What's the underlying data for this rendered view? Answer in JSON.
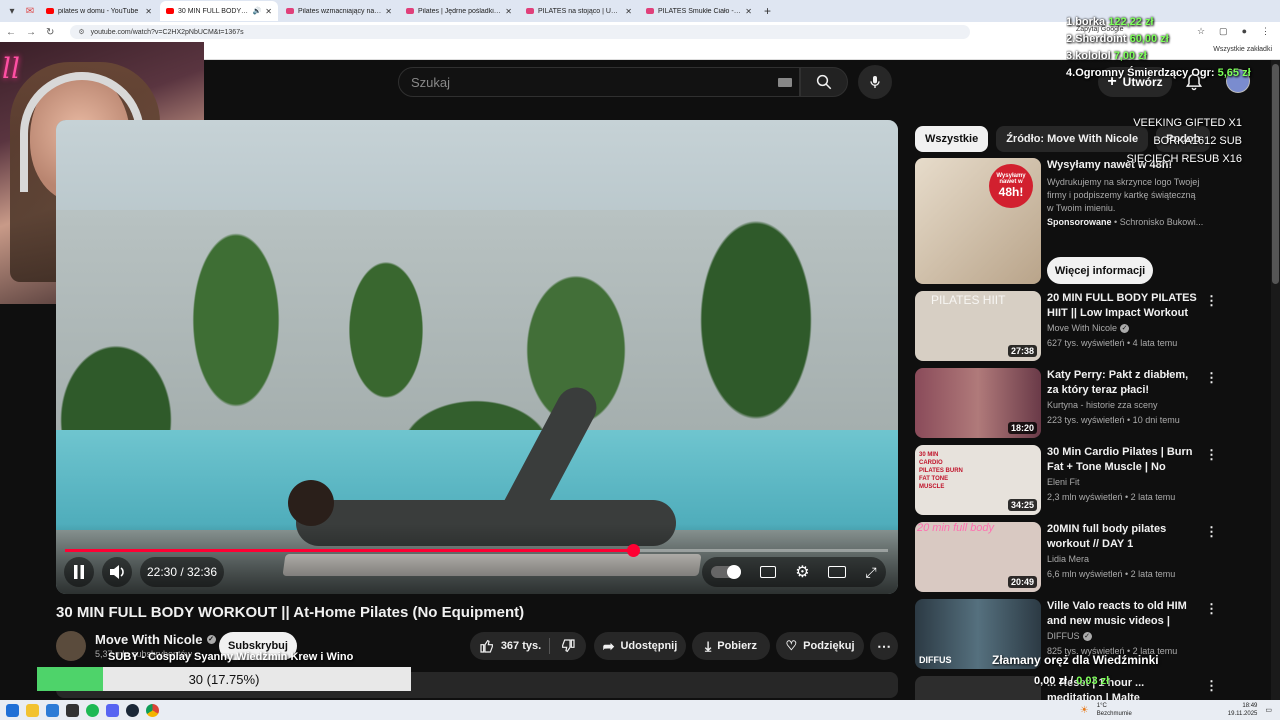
{
  "browser": {
    "tabs": [
      {
        "label": "pilates w domu - YouTube",
        "active": false
      },
      {
        "label": "30 MIN FULL BODY WORKO...",
        "active": true
      },
      {
        "label": "Pilates wzmacniający na całe ciało",
        "active": false
      },
      {
        "label": "Pilates | Jędrne pośladki i płaski",
        "active": false
      },
      {
        "label": "PILATES na stojąco | Uda i Brzuch",
        "active": false
      },
      {
        "label": "PILATES Smukłe Ciało - YouTube",
        "active": false
      }
    ],
    "url": "youtube.com/watch?v=C2HX2pNbUCM&t=1367s",
    "translate_label": "Zapytaj Google",
    "bookmarks_label": "Wszystkie zakładki"
  },
  "overlay": {
    "donations": [
      {
        "rank": "1.",
        "name": "borka",
        "amount": "122,22 zł"
      },
      {
        "rank": "2.",
        "name": "Sherdoint",
        "amount": "60,00 zł"
      },
      {
        "rank": "3.",
        "name": "kololol",
        "amount": "7,00 zł"
      },
      {
        "rank": "4.",
        "name": "Ogromny Śmierdzący Ogr:",
        "amount": "5,65 zł"
      }
    ],
    "gifted": [
      "VEEKING GIFTED X1",
      "BORKA1612 SUB",
      "SIECIECH RESUB X16"
    ],
    "subgoal_title": "SUBY - Cosplay Syanny Wiedźmin Krew i Wino",
    "subgoal_text": "30 (17.75%)",
    "subgoal_progress": 0.1775,
    "overlay_wiedz": "Złamany oręż dla Wiedźminki",
    "overlay_price_a": "0,00 zł",
    "overlay_price_b": "0,03 zł"
  },
  "header": {
    "search_placeholder": "Szukaj",
    "create_label": "Utwórz"
  },
  "player": {
    "time": "22:30 / 32:36",
    "progress": 0.69
  },
  "video": {
    "title": "30 MIN FULL BODY WORKOUT || At-Home Pilates (No Equipment)",
    "channel": "Move With Nicole",
    "subscribers": "5,37 mln subskrybentów",
    "subscribe_label": "Subskrybuj",
    "likes": "367 tys.",
    "share_label": "Udostępnij",
    "download_label": "Pobierz",
    "thanks_label": "Podziękuj"
  },
  "sidebar": {
    "chips": [
      "Wszystkie",
      "Źródło: Move With Nicole",
      "Podob"
    ],
    "ad": {
      "badge_small": "Wysyłamy nawet w",
      "badge_big": "48h!",
      "title": "Wysyłamy nawet w 48h!",
      "desc": "Wydrukujemy na skrzynce logo Twojej firmy i podpiszemy kartkę świąteczną w Twoim imieniu.",
      "sponsored": "Sponsorowane",
      "advertiser": "Schronisko Bukowi...",
      "more_label": "Więcej informacji"
    },
    "recs": [
      {
        "title": "20 MIN FULL BODY PILATES HIIT || Low Impact Workout ...",
        "channel": "Move With Nicole",
        "verified": true,
        "meta": "627 tys. wyświetleń • 4 lata temu",
        "duration": "27:38",
        "thumb_text": "PILATES HIIT",
        "thumb_color": "#d7cfc4"
      },
      {
        "title": "Katy Perry: Pakt z diabłem, za który teraz płaci!",
        "channel": "Kurtyna - historie zza sceny",
        "verified": false,
        "meta": "223 tys. wyświetleń • 10 dni temu",
        "duration": "18:20",
        "thumb_text": "",
        "thumb_color": "#8a4b5a"
      },
      {
        "title": "30 Min Cardio Pilates | Burn Fat + Tone Muscle | No Jumping | ...",
        "channel": "Eleni Fit",
        "verified": false,
        "meta": "2,3 mln wyświetleń • 2 lata temu",
        "duration": "34:25",
        "thumb_text": "30 MIN CARDIO PILATES BURN FAT TONE MUSCLE",
        "thumb_color": "#e7e2dc"
      },
      {
        "title": "20MIN full body pilates workout // DAY 1 CHALLENGE // no ...",
        "channel": "Lidia Mera",
        "verified": false,
        "meta": "6,6 mln wyświetleń • 2 lata temu",
        "duration": "20:49",
        "thumb_text": "20 min full body",
        "thumb_color": "#d9c9c2"
      },
      {
        "title": "Ville Valo reacts to old HIM and new music videos | DIFFUS",
        "channel": "DIFFUS",
        "verified": true,
        "meta": "825 tys. wyświetleń • 2 lata temu",
        "duration": "",
        "thumb_text": "DIFFUS",
        "thumb_color": "#3a4b55"
      },
      {
        "title": "... Reset | 1 hour ... meditation | Malte",
        "channel": "",
        "verified": false,
        "meta": "",
        "duration": "",
        "thumb_text": "",
        "thumb_color": "#2d2d2d"
      }
    ]
  },
  "taskbar": {
    "weather_temp": "1°C",
    "weather_desc": "Bezchmurnie",
    "time": "18:49",
    "date": "19.11.2025"
  },
  "colors": {
    "accent_red": "#ff0033",
    "bg": "#0f0f0f",
    "donation_green": "#7dff5a",
    "goal_green": "#4ed36a"
  }
}
